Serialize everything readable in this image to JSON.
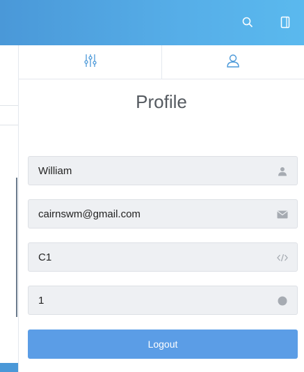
{
  "topbar": {
    "icons": [
      "search-icon",
      "panel-toggle-icon"
    ],
    "background": "#56aee8"
  },
  "tabs": [
    {
      "name": "settings",
      "icon": "sliders-icon"
    },
    {
      "name": "profile",
      "icon": "user-icon"
    }
  ],
  "panel": {
    "title": "Profile"
  },
  "fields": {
    "name": {
      "value": "William",
      "icon": "user-icon"
    },
    "email": {
      "value": "cairnswm@gmail.com",
      "icon": "envelope-icon"
    },
    "code": {
      "value": "C1",
      "icon": "code-icon"
    },
    "number": {
      "value": "1",
      "icon": "circle-icon"
    }
  },
  "logout": {
    "label": "Logout",
    "color": "#5b9de6"
  }
}
